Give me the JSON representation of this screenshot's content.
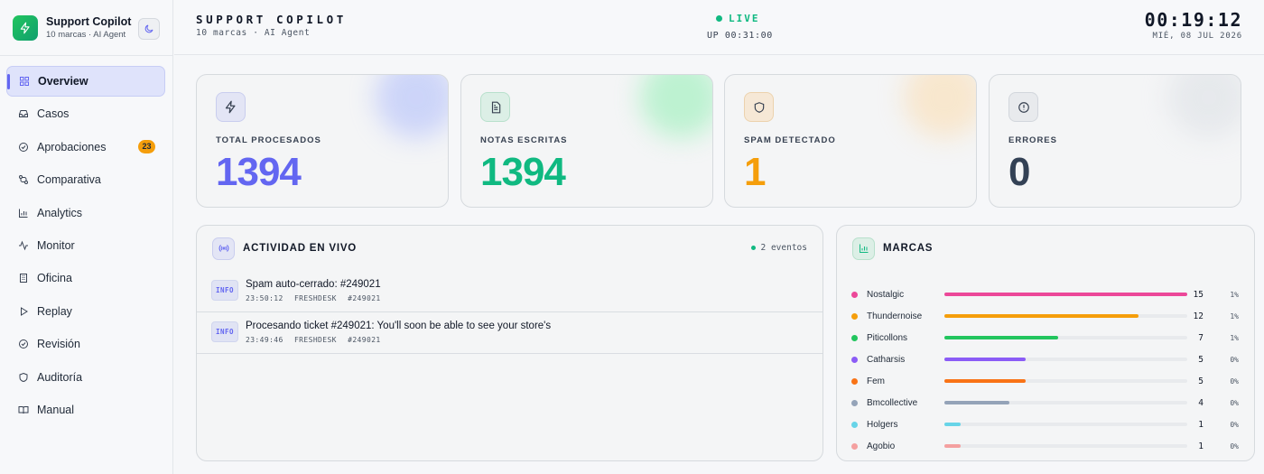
{
  "app": {
    "name": "Support Copilot",
    "subtitle": "10 marcas · AI Agent"
  },
  "sidebar": {
    "items": [
      {
        "label": "Overview",
        "icon": "grid-icon",
        "active": true
      },
      {
        "label": "Casos",
        "icon": "inbox-icon"
      },
      {
        "label": "Aprobaciones",
        "icon": "check-circle-icon",
        "badge": "23"
      },
      {
        "label": "Comparativa",
        "icon": "compare-icon"
      },
      {
        "label": "Analytics",
        "icon": "bar-chart-icon"
      },
      {
        "label": "Monitor",
        "icon": "activity-icon"
      },
      {
        "label": "Oficina",
        "icon": "building-icon"
      },
      {
        "label": "Replay",
        "icon": "play-icon"
      },
      {
        "label": "Revisión",
        "icon": "check-circle-icon"
      },
      {
        "label": "Auditoría",
        "icon": "shield-icon"
      },
      {
        "label": "Manual",
        "icon": "book-icon"
      }
    ]
  },
  "header": {
    "title": "SUPPORT COPILOT",
    "subtitle": "10 marcas · AI Agent",
    "live": "LIVE",
    "uptime": "UP 00:31:00",
    "clock": "00:19:12",
    "date": "MIÉ, 08 JUL 2026"
  },
  "stats": [
    {
      "label": "TOTAL PROCESADOS",
      "value": "1394",
      "icon": "bolt-icon",
      "color": "#6366f1"
    },
    {
      "label": "NOTAS ESCRITAS",
      "value": "1394",
      "icon": "document-icon",
      "color": "#10b981"
    },
    {
      "label": "SPAM DETECTADO",
      "value": "1",
      "icon": "shield-icon",
      "color": "#f59e0b"
    },
    {
      "label": "ERRORES",
      "value": "0",
      "icon": "alert-circle-icon",
      "color": "#334155"
    }
  ],
  "activity": {
    "title": "ACTIVIDAD EN VIVO",
    "events_label": "2 eventos",
    "rows": [
      {
        "tag": "INFO",
        "message": "Spam auto-cerrado: #249021",
        "time": "23:50:12",
        "source": "FRESHDESK",
        "ticket": "#249021"
      },
      {
        "tag": "INFO",
        "message": "Procesando ticket #249021: You'll soon be able to see your store's",
        "time": "23:49:46",
        "source": "FRESHDESK",
        "ticket": "#249021"
      }
    ]
  },
  "brands": {
    "title": "MARCAS",
    "max": 15,
    "rows": [
      {
        "name": "Nostalgic",
        "count": 15,
        "pct": "1%",
        "color": "#ec4899"
      },
      {
        "name": "Thundernoise",
        "count": 12,
        "pct": "1%",
        "color": "#f59e0b"
      },
      {
        "name": "Piticollons",
        "count": 7,
        "pct": "1%",
        "color": "#22c55e"
      },
      {
        "name": "Catharsis",
        "count": 5,
        "pct": "0%",
        "color": "#8b5cf6"
      },
      {
        "name": "Fem",
        "count": 5,
        "pct": "0%",
        "color": "#f97316"
      },
      {
        "name": "Bmcollective",
        "count": 4,
        "pct": "0%",
        "color": "#94a3b8"
      },
      {
        "name": "Holgers",
        "count": 1,
        "pct": "0%",
        "color": "#67d4e8"
      },
      {
        "name": "Agobio",
        "count": 1,
        "pct": "0%",
        "color": "#f4a0a0"
      }
    ]
  }
}
